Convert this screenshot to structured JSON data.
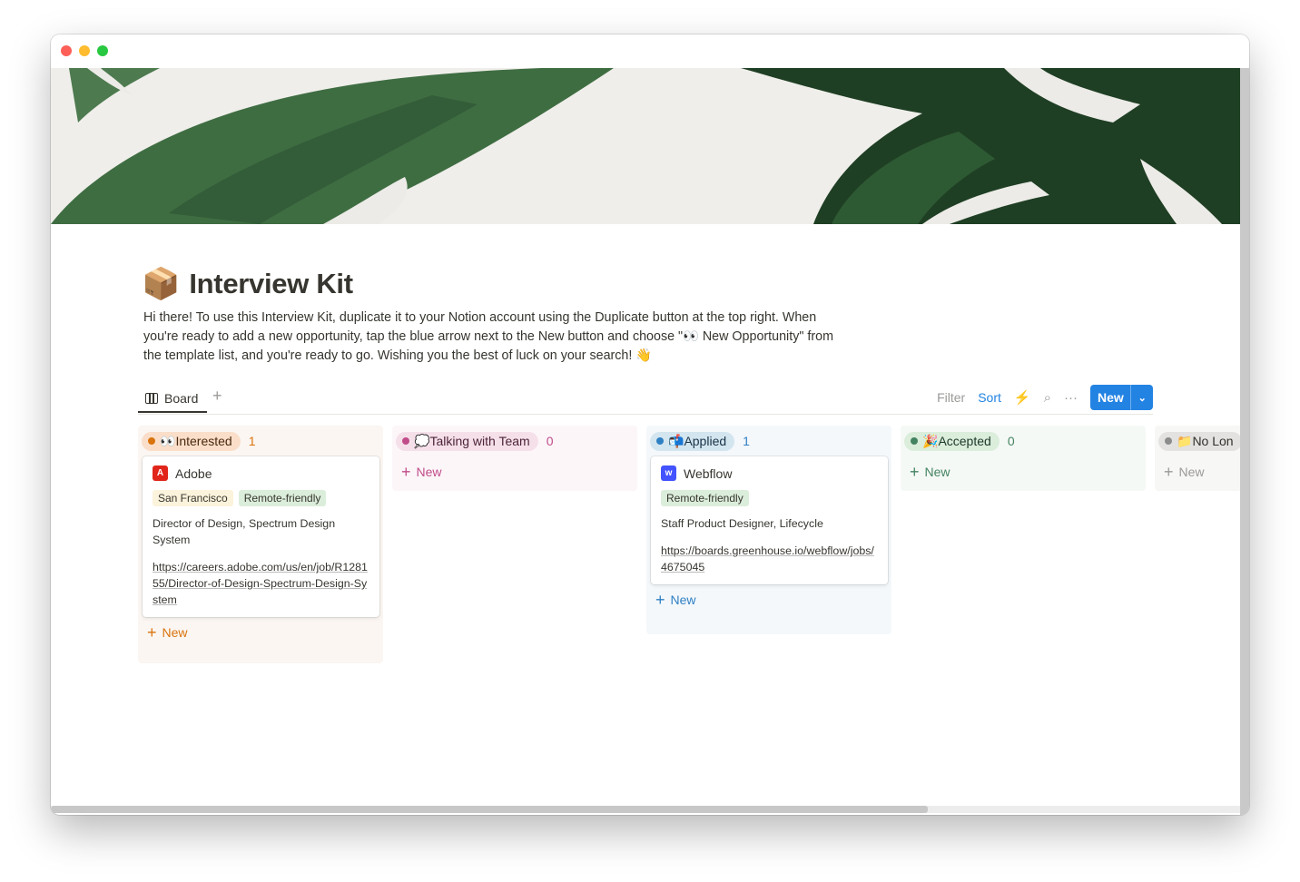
{
  "page": {
    "icon": "📦",
    "title": "Interview Kit",
    "description": "Hi there! To use this Interview Kit, duplicate it to your Notion account using the Duplicate button at the top right. When you're ready to add a new opportunity, tap the blue arrow next to the New button and choose \"👀 New Opportunity\" from the template list, and you're ready to go. Wishing you the best of luck on your search! 👋"
  },
  "views": {
    "tabs": [
      {
        "label": "Board",
        "icon": "board-icon"
      }
    ],
    "add_icon": "+",
    "filter_label": "Filter",
    "sort_label": "Sort",
    "automation_icon": "⚡",
    "search_icon": "⌕",
    "more_icon": "···",
    "new_label": "New",
    "new_caret": "⌄"
  },
  "board": {
    "columns": [
      {
        "emoji": "👀",
        "label": "Interested",
        "count": "1",
        "dot_color": "#d9730d",
        "pill_bg": "#fadec9",
        "text_color": "#49290e",
        "count_color": "#d9730d",
        "col_bg": "#fbf6f2",
        "new_label": "New",
        "new_color": "#d9730d"
      },
      {
        "emoji": "💭",
        "label": "Talking with Team",
        "count": "0",
        "dot_color": "#c14c8a",
        "pill_bg": "#f5e0e9",
        "text_color": "#4c2337",
        "count_color": "#c14c8a",
        "col_bg": "#fcf6f9",
        "new_label": "New",
        "new_color": "#c14c8a"
      },
      {
        "emoji": "📬",
        "label": "Applied",
        "count": "1",
        "dot_color": "#2f80c3",
        "pill_bg": "#d3e5ef",
        "text_color": "#183347",
        "count_color": "#2f80c3",
        "col_bg": "#f4f8fb",
        "new_label": "New",
        "new_color": "#2f80c3"
      },
      {
        "emoji": "🎉",
        "label": "Accepted",
        "count": "0",
        "dot_color": "#448361",
        "pill_bg": "#dbeddb",
        "text_color": "#1c3829",
        "count_color": "#448361",
        "col_bg": "#f5f9f6",
        "new_label": "New",
        "new_color": "#448361"
      },
      {
        "emoji": "📁",
        "label": "No Lon",
        "count": "",
        "dot_color": "#8c8c8c",
        "pill_bg": "#e3e2e0",
        "text_color": "#32302c",
        "count_color": "#9b9a97",
        "col_bg": "#f7f7f5",
        "new_label": "New",
        "new_color": "#9b9a97"
      }
    ],
    "cards": {
      "adobe": {
        "company": "Adobe",
        "logo_color": "#e1251b",
        "logo_text": "A",
        "tags": [
          "San Francisco",
          "Remote-friendly"
        ],
        "role": "Director of Design, Spectrum Design System",
        "url": "https://careers.adobe.com/us/en/job/R128155/Director-of-Design-Spectrum-Design-System"
      },
      "webflow": {
        "company": "Webflow",
        "logo_color": "#4353ff",
        "logo_text": "w",
        "tags": [
          "Remote-friendly"
        ],
        "role": "Staff Product Designer, Lifecycle",
        "url": "https://boards.greenhouse.io/webflow/jobs/4675045"
      }
    }
  }
}
